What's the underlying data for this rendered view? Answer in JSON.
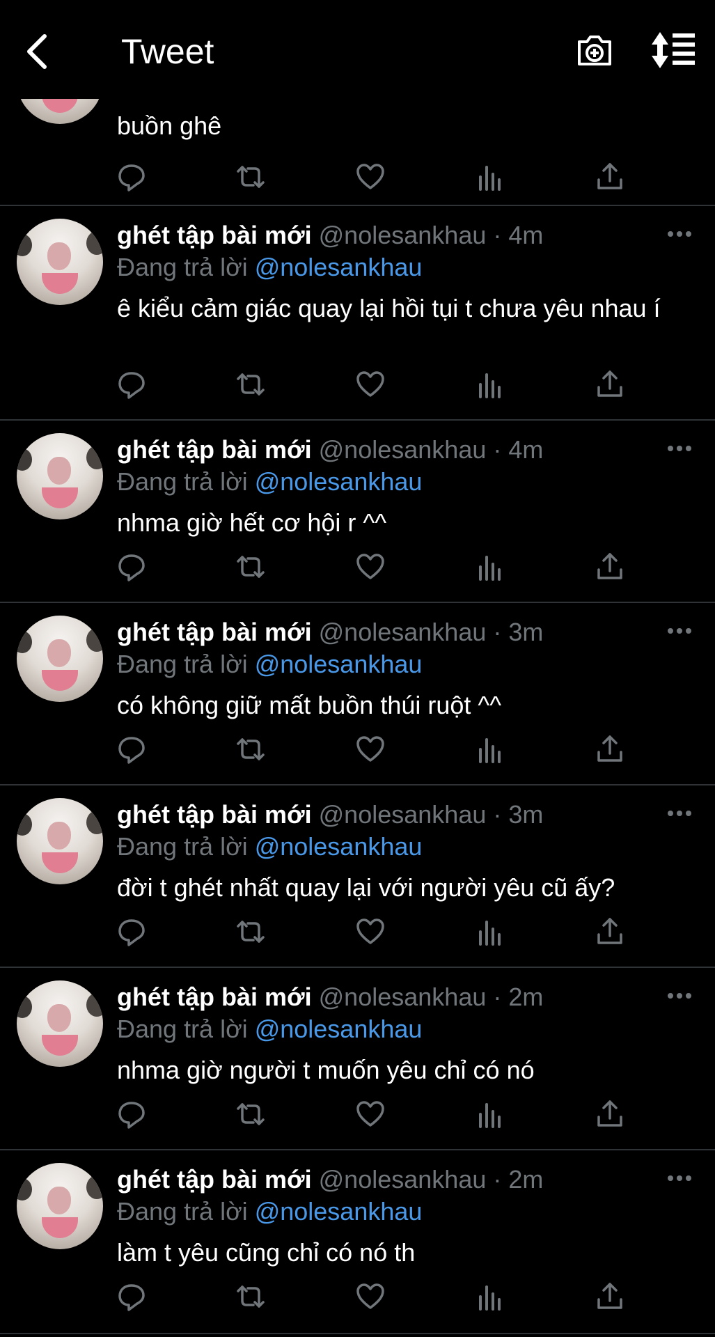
{
  "header": {
    "title": "Tweet",
    "back_icon": "chevron-left-icon",
    "camera_icon": "camera-plus-icon",
    "sort_icon": "sort-icon"
  },
  "colors": {
    "background": "#000000",
    "text": "#ffffff",
    "muted": "#71767b",
    "link": "#4a99e9",
    "divider": "#2f3336"
  },
  "top_tweet": {
    "text": "buồn ghê"
  },
  "tweets": [
    {
      "name": "ghét tập bài mới",
      "handle": "@nolesankhau",
      "dot": "·",
      "time": "4m",
      "replying_prefix": "Đang trả lời",
      "replying_to": "@nolesankhau",
      "text": "ê kiểu cảm giác quay lại hồi tụi t chưa yêu nhau í"
    },
    {
      "name": "ghét tập bài mới",
      "handle": "@nolesankhau",
      "dot": "·",
      "time": "4m",
      "replying_prefix": "Đang trả lời",
      "replying_to": "@nolesankhau",
      "text": "nhma giờ hết cơ hội r ^^"
    },
    {
      "name": "ghét tập bài mới",
      "handle": "@nolesankhau",
      "dot": "·",
      "time": "3m",
      "replying_prefix": "Đang trả lời",
      "replying_to": "@nolesankhau",
      "text": "có không giữ mất buồn thúi ruột ^^"
    },
    {
      "name": "ghét tập bài mới",
      "handle": "@nolesankhau",
      "dot": "·",
      "time": "3m",
      "replying_prefix": "Đang trả lời",
      "replying_to": "@nolesankhau",
      "text": "đời t ghét nhất quay lại với người yêu cũ ấy?"
    },
    {
      "name": "ghét tập bài mới",
      "handle": "@nolesankhau",
      "dot": "·",
      "time": "2m",
      "replying_prefix": "Đang trả lời",
      "replying_to": "@nolesankhau",
      "text": "nhma giờ người t muốn yêu chỉ có nó"
    },
    {
      "name": "ghét tập bài mới",
      "handle": "@nolesankhau",
      "dot": "·",
      "time": "2m",
      "replying_prefix": "Đang trả lời",
      "replying_to": "@nolesankhau",
      "text": "làm t yêu cũng chỉ có nó th"
    }
  ],
  "action_icons": [
    "reply-icon",
    "retweet-icon",
    "like-icon",
    "analytics-icon",
    "share-icon"
  ]
}
